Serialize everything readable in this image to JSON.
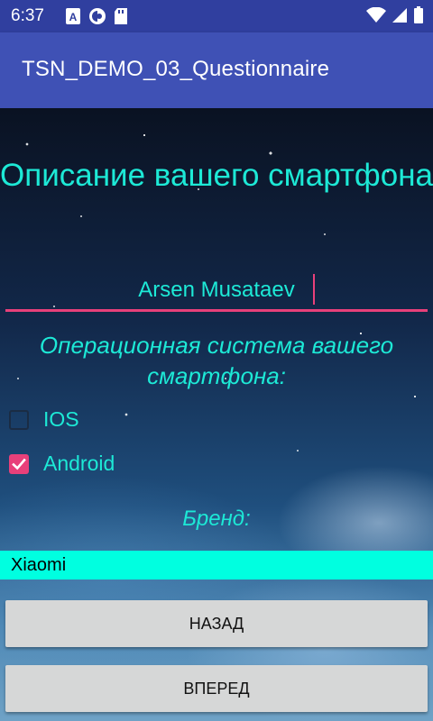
{
  "status_bar": {
    "time": "6:37",
    "left_icons": [
      "a-notification-icon",
      "sync-circle-icon",
      "sd-card-icon"
    ],
    "right_icons": [
      "wifi-icon",
      "signal-icon",
      "battery-icon"
    ]
  },
  "app_bar": {
    "title": "TSN_DEMO_03_Questionnaire"
  },
  "form": {
    "heading": "Описание вашего смартфона",
    "name_value": "Arsen Musataev",
    "os_label": "Операционная система вашего смартфона:",
    "options": [
      {
        "label": "IOS",
        "checked": false
      },
      {
        "label": "Android",
        "checked": true
      }
    ],
    "brand_label": "Бренд:",
    "brand_value": "Xiaomi"
  },
  "buttons": {
    "back": "НАЗАД",
    "next": "ВПЕРЕД"
  },
  "colors": {
    "accent": "#1de9d6",
    "pink": "#e8407a",
    "app_bar": "#3f51b5",
    "status_bar": "#303f9f",
    "spinner_bg": "#00ffe0"
  }
}
